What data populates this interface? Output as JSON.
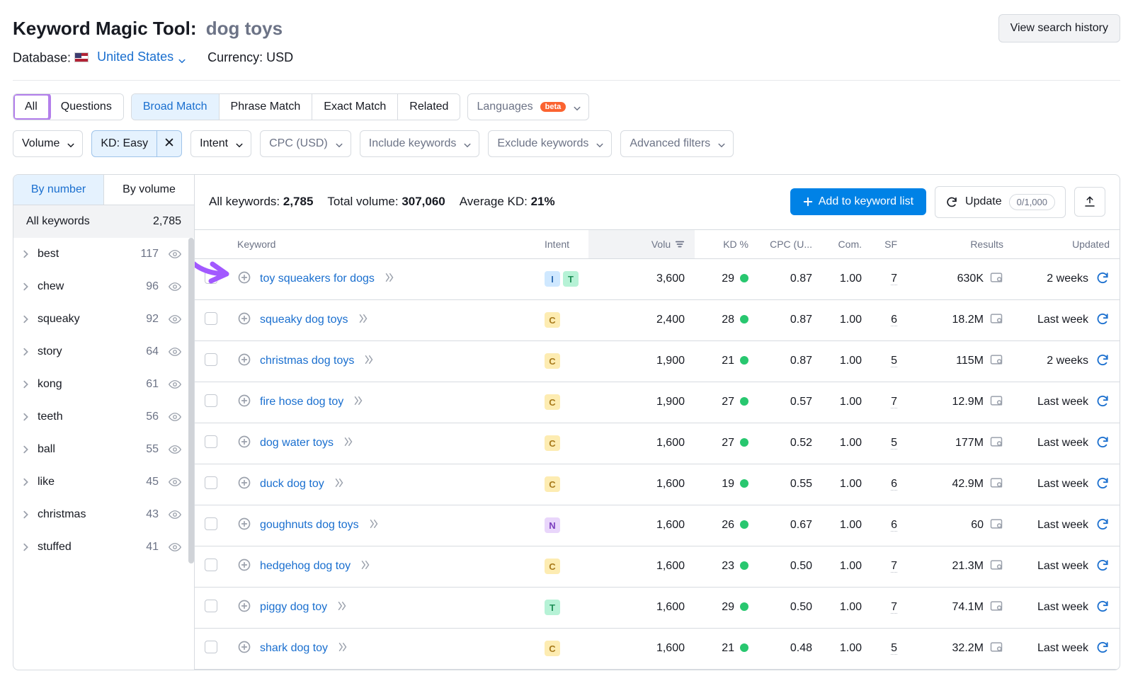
{
  "header": {
    "tool": "Keyword Magic Tool:",
    "query": "dog toys",
    "history_btn": "View search history",
    "db_label": "Database:",
    "db_value": "United States",
    "currency_label": "Currency: USD"
  },
  "tabs1": {
    "all": "All",
    "questions": "Questions"
  },
  "tabs2": {
    "broad": "Broad Match",
    "phrase": "Phrase Match",
    "exact": "Exact Match",
    "related": "Related"
  },
  "lang": {
    "label": "Languages",
    "pill": "beta"
  },
  "filters": {
    "volume": "Volume",
    "kd": "KD: Easy",
    "intent": "Intent",
    "cpc": "CPC (USD)",
    "include": "Include keywords",
    "exclude": "Exclude keywords",
    "advanced": "Advanced filters"
  },
  "sidebar": {
    "by_number": "By number",
    "by_volume": "By volume",
    "all_label": "All keywords",
    "all_count": "2,785",
    "items": [
      {
        "name": "best",
        "count": "117"
      },
      {
        "name": "chew",
        "count": "96"
      },
      {
        "name": "squeaky",
        "count": "92"
      },
      {
        "name": "story",
        "count": "64"
      },
      {
        "name": "kong",
        "count": "61"
      },
      {
        "name": "teeth",
        "count": "56"
      },
      {
        "name": "ball",
        "count": "55"
      },
      {
        "name": "like",
        "count": "45"
      },
      {
        "name": "christmas",
        "count": "43"
      },
      {
        "name": "stuffed",
        "count": "41"
      }
    ]
  },
  "summary": {
    "all_kw_lbl": "All keywords: ",
    "all_kw": "2,785",
    "vol_lbl": "Total volume: ",
    "vol": "307,060",
    "kd_lbl": "Average KD: ",
    "kd": "21%",
    "add_btn": "Add to keyword list",
    "update": "Update",
    "update_count": "0/1,000"
  },
  "columns": {
    "keyword": "Keyword",
    "intent": "Intent",
    "volume": "Volu",
    "kd": "KD %",
    "cpc": "CPC (U...",
    "com": "Com.",
    "sf": "SF",
    "results": "Results",
    "updated": "Updated"
  },
  "rows": [
    {
      "kw": "toy squeakers for dogs",
      "intent": [
        "I",
        "T"
      ],
      "vol": "3,600",
      "kd": "29",
      "cpc": "0.87",
      "com": "1.00",
      "sf": "7",
      "results": "630K",
      "updated": "2 weeks"
    },
    {
      "kw": "squeaky dog toys",
      "intent": [
        "C"
      ],
      "vol": "2,400",
      "kd": "28",
      "cpc": "0.87",
      "com": "1.00",
      "sf": "6",
      "results": "18.2M",
      "updated": "Last week"
    },
    {
      "kw": "christmas dog toys",
      "intent": [
        "C"
      ],
      "vol": "1,900",
      "kd": "21",
      "cpc": "0.87",
      "com": "1.00",
      "sf": "5",
      "results": "115M",
      "updated": "2 weeks"
    },
    {
      "kw": "fire hose dog toy",
      "intent": [
        "C"
      ],
      "vol": "1,900",
      "kd": "27",
      "cpc": "0.57",
      "com": "1.00",
      "sf": "7",
      "results": "12.9M",
      "updated": "Last week"
    },
    {
      "kw": "dog water toys",
      "intent": [
        "C"
      ],
      "vol": "1,600",
      "kd": "27",
      "cpc": "0.52",
      "com": "1.00",
      "sf": "5",
      "results": "177M",
      "updated": "Last week"
    },
    {
      "kw": "duck dog toy",
      "intent": [
        "C"
      ],
      "vol": "1,600",
      "kd": "19",
      "cpc": "0.55",
      "com": "1.00",
      "sf": "6",
      "results": "42.9M",
      "updated": "Last week"
    },
    {
      "kw": "goughnuts dog toys",
      "intent": [
        "N"
      ],
      "vol": "1,600",
      "kd": "26",
      "cpc": "0.67",
      "com": "1.00",
      "sf": "6",
      "results": "60",
      "updated": "Last week"
    },
    {
      "kw": "hedgehog dog toy",
      "intent": [
        "C"
      ],
      "vol": "1,600",
      "kd": "23",
      "cpc": "0.50",
      "com": "1.00",
      "sf": "7",
      "results": "21.3M",
      "updated": "Last week"
    },
    {
      "kw": "piggy dog toy",
      "intent": [
        "T"
      ],
      "vol": "1,600",
      "kd": "29",
      "cpc": "0.50",
      "com": "1.00",
      "sf": "7",
      "results": "74.1M",
      "updated": "Last week"
    },
    {
      "kw": "shark dog toy",
      "intent": [
        "C"
      ],
      "vol": "1,600",
      "kd": "21",
      "cpc": "0.48",
      "com": "1.00",
      "sf": "5",
      "results": "32.2M",
      "updated": "Last week"
    }
  ]
}
